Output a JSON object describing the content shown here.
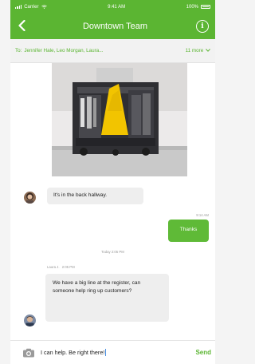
{
  "status_bar": {
    "carrier": "Carrier",
    "time": "9:41 AM",
    "battery": "100%"
  },
  "nav": {
    "title": "Downtown Team",
    "back_icon": "chevron-left-icon",
    "info_icon": "info-icon"
  },
  "recipients": {
    "label": "To:",
    "names": "Jennifer Hale, Leo Morgan, Laura...",
    "more": "11 more"
  },
  "messages": [
    {
      "direction": "in",
      "text": "It's in the back hallway."
    },
    {
      "direction": "out",
      "timestamp": "9:14 AM",
      "text": "Thanks"
    },
    {
      "type": "divider",
      "text": "Today 2:05 PM"
    },
    {
      "direction": "in",
      "sender": "Laura J.",
      "time": "2:05 PM",
      "text": "We have a big line at the register, can someone help ring up customers?"
    }
  ],
  "composer": {
    "value": "I can help. Be right there!",
    "send_label": "Send",
    "camera_icon": "camera-icon"
  },
  "colors": {
    "brand": "#5bb532",
    "incoming_bubble": "#eeeeee",
    "outgoing_bubble": "#5fba37"
  }
}
